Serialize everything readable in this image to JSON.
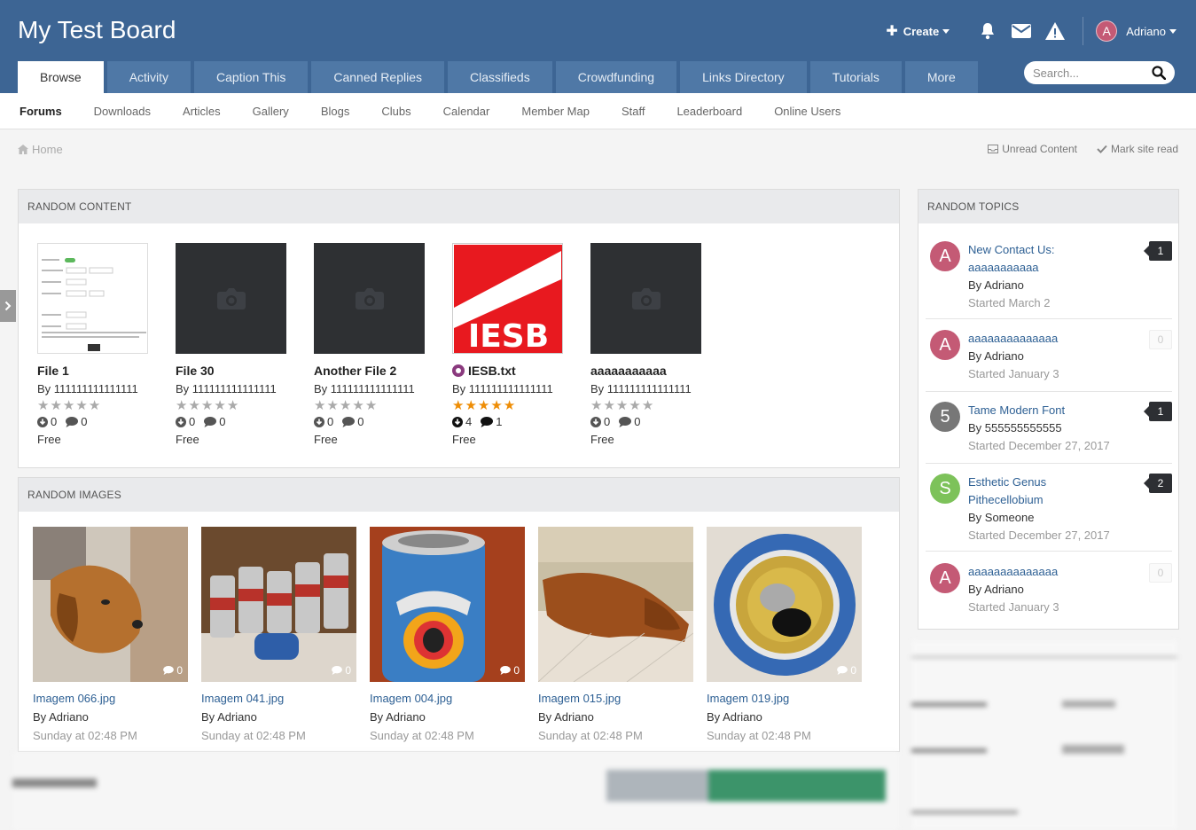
{
  "header": {
    "title": "My Test Board",
    "create_label": "Create",
    "user_name": "Adriano",
    "user_initial": "A"
  },
  "nav": {
    "tabs": [
      "Browse",
      "Activity",
      "Caption This",
      "Canned Replies",
      "Classifieds",
      "Crowdfunding",
      "Links Directory",
      "Tutorials",
      "More"
    ],
    "search_placeholder": "Search..."
  },
  "subnav": {
    "items": [
      "Forums",
      "Downloads",
      "Articles",
      "Gallery",
      "Blogs",
      "Clubs",
      "Calendar",
      "Member Map",
      "Staff",
      "Leaderboard",
      "Online Users"
    ]
  },
  "breadcrumb": {
    "home": "Home",
    "unread": "Unread Content",
    "mark_read": "Mark site read"
  },
  "random_content": {
    "heading": "Random Content",
    "items": [
      {
        "title": "File 1",
        "by": "By 111111111111111",
        "rating": 0,
        "downloads": "0",
        "comments": "0",
        "price": "Free"
      },
      {
        "title": "File 30",
        "by": "By 111111111111111",
        "rating": 0,
        "downloads": "0",
        "comments": "0",
        "price": "Free"
      },
      {
        "title": "Another File 2",
        "by": "By 111111111111111",
        "rating": 0,
        "downloads": "0",
        "comments": "0",
        "price": "Free"
      },
      {
        "title": "IESB.txt",
        "by": "By 111111111111111",
        "rating": 5,
        "downloads": "4",
        "comments": "1",
        "price": "Free",
        "thumb_text": "IESB"
      },
      {
        "title": "aaaaaaaaaaa",
        "by": "By 111111111111111",
        "rating": 0,
        "downloads": "0",
        "comments": "0",
        "price": "Free"
      }
    ]
  },
  "random_images": {
    "heading": "Random Images",
    "items": [
      {
        "name": "Imagem 066.jpg",
        "by": "By Adriano",
        "date": "Sunday at 02:48 PM",
        "comments": "0"
      },
      {
        "name": "Imagem 041.jpg",
        "by": "By Adriano",
        "date": "Sunday at 02:48 PM",
        "comments": "0"
      },
      {
        "name": "Imagem 004.jpg",
        "by": "By Adriano",
        "date": "Sunday at 02:48 PM",
        "comments": "0"
      },
      {
        "name": "Imagem 015.jpg",
        "by": "By Adriano",
        "date": "Sunday at 02:48 PM",
        "comments": "0"
      },
      {
        "name": "Imagem 019.jpg",
        "by": "By Adriano",
        "date": "Sunday at 02:48 PM",
        "comments": "0"
      }
    ]
  },
  "random_topics": {
    "heading": "Random Topics",
    "items": [
      {
        "initial": "A",
        "color": "#c45a75",
        "title_1": "New Contact Us:",
        "title_2": "aaaaaaaaaaa",
        "by": "By Adriano",
        "date": "Started March 2",
        "count": "1"
      },
      {
        "initial": "A",
        "color": "#c45a75",
        "title_1": "aaaaaaaaaaaaaa",
        "title_2": "",
        "by": "By Adriano",
        "date": "Started January 3",
        "count": "0"
      },
      {
        "initial": "5",
        "color": "#777777",
        "title_1": "Tame Modern Font",
        "title_2": "",
        "by": "By 555555555555",
        "date": "Started December 27, 2017",
        "count": "1"
      },
      {
        "initial": "S",
        "color": "#7dc25a",
        "title_1": "Esthetic Genus",
        "title_2": "Pithecellobium",
        "by": "By Someone",
        "date": "Started December 27, 2017",
        "count": "2"
      },
      {
        "initial": "A",
        "color": "#c45a75",
        "title_1": "aaaaaaaaaaaaaa",
        "title_2": "",
        "by": "By Adriano",
        "date": "Started January 3",
        "count": "0"
      }
    ]
  },
  "colors": {
    "header_bg": "#3d6594",
    "link": "#2e6094",
    "star_on": "#ee8d05"
  }
}
